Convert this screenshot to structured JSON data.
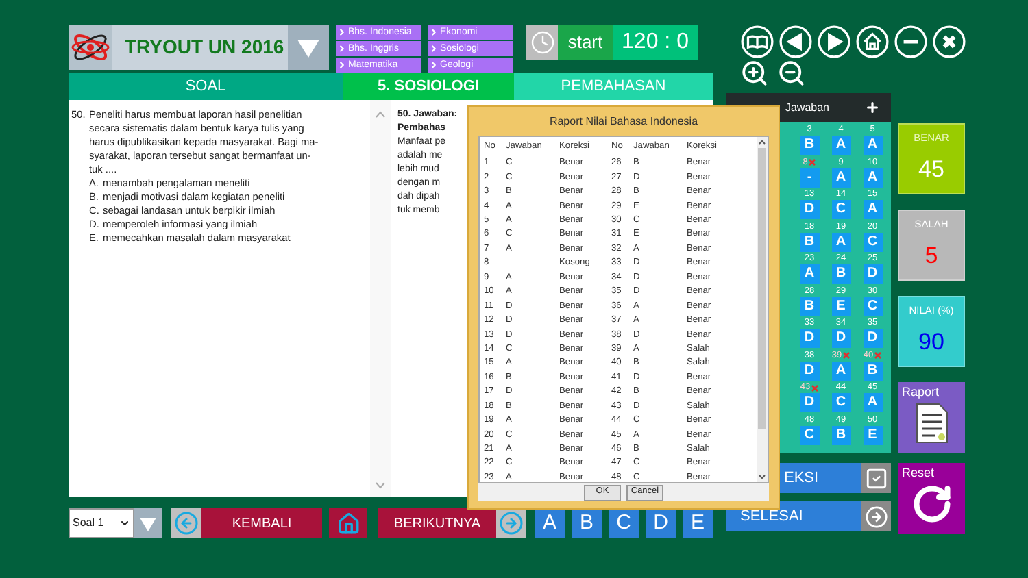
{
  "header": {
    "title": "TRYOUT UN 2016",
    "subjects": [
      {
        "label": "Bhs. Indonesia"
      },
      {
        "label": "Bhs. Inggris"
      },
      {
        "label": "Matematika"
      },
      {
        "label": "Ekonomi"
      },
      {
        "label": "Sosiologi"
      },
      {
        "label": "Geologi"
      }
    ],
    "start": "start",
    "timer": "120 : 0"
  },
  "tabs": [
    {
      "label": "SOAL",
      "selected": false,
      "color": "#00a884"
    },
    {
      "label": "5. SOSIOLOGI",
      "selected": true,
      "color": "#00c04b"
    },
    {
      "label": "PEMBAHASAN",
      "selected": false,
      "color": "#22d6a8"
    }
  ],
  "question": {
    "number": "50.",
    "lines": [
      "Peneliti harus membuat laporan hasil penelitian",
      "secara sistematis dalam bentuk karya tulis yang",
      "harus dipublikasikan kepada masyarakat. Bagi ma-",
      "syarakat, laporan tersebut sangat bermanfaat un-",
      "tuk ...."
    ],
    "options": [
      {
        "letter": "A.",
        "text": "menambah pengalaman meneliti"
      },
      {
        "letter": "B.",
        "text": "menjadi motivasi dalam kegiatan peneliti"
      },
      {
        "letter": "C.",
        "text": "sebagai landasan untuk berpikir ilmiah"
      },
      {
        "letter": "D.",
        "text": "memperoleh informasi yang ilmiah"
      },
      {
        "letter": "E.",
        "text": "memecahkan masalah dalam masyarakat"
      }
    ]
  },
  "discussion": {
    "title": "50. Jawaban:",
    "heading": "Pembahas",
    "lines": [
      "Manfaat pe",
      "adalah me",
      "lebih mud",
      "dengan m",
      "dah dipah",
      "tuk memb"
    ]
  },
  "dialog": {
    "title": "Raport Nilai Bahasa Indonesia",
    "columns": [
      "No",
      "Jawaban",
      "Koreksi",
      "No",
      "Jawaban",
      "Koreksi"
    ],
    "rows": [
      [
        "1",
        "C",
        "Benar",
        "26",
        "B",
        "Benar"
      ],
      [
        "2",
        "C",
        "Benar",
        "27",
        "D",
        "Benar"
      ],
      [
        "3",
        "B",
        "Benar",
        "28",
        "B",
        "Benar"
      ],
      [
        "4",
        "A",
        "Benar",
        "29",
        "E",
        "Benar"
      ],
      [
        "5",
        "A",
        "Benar",
        "30",
        "C",
        "Benar"
      ],
      [
        "6",
        "C",
        "Benar",
        "31",
        "E",
        "Benar"
      ],
      [
        "7",
        "A",
        "Benar",
        "32",
        "A",
        "Benar"
      ],
      [
        "8",
        "-",
        "Kosong",
        "33",
        "D",
        "Benar"
      ],
      [
        "9",
        "A",
        "Benar",
        "34",
        "D",
        "Benar"
      ],
      [
        "10",
        "A",
        "Benar",
        "35",
        "D",
        "Benar"
      ],
      [
        "11",
        "D",
        "Benar",
        "36",
        "A",
        "Benar"
      ],
      [
        "12",
        "D",
        "Benar",
        "37",
        "A",
        "Benar"
      ],
      [
        "13",
        "D",
        "Benar",
        "38",
        "D",
        "Benar"
      ],
      [
        "14",
        "C",
        "Benar",
        "39",
        "A",
        "Salah"
      ],
      [
        "15",
        "A",
        "Benar",
        "40",
        "B",
        "Salah"
      ],
      [
        "16",
        "B",
        "Benar",
        "41",
        "D",
        "Benar"
      ],
      [
        "17",
        "D",
        "Benar",
        "42",
        "B",
        "Benar"
      ],
      [
        "18",
        "B",
        "Benar",
        "43",
        "D",
        "Salah"
      ],
      [
        "19",
        "A",
        "Benar",
        "44",
        "C",
        "Benar"
      ],
      [
        "20",
        "C",
        "Benar",
        "45",
        "A",
        "Benar"
      ],
      [
        "21",
        "A",
        "Benar",
        "46",
        "B",
        "Salah"
      ],
      [
        "22",
        "C",
        "Benar",
        "47",
        "C",
        "Benar"
      ],
      [
        "23",
        "A",
        "Benar",
        "48",
        "C",
        "Benar"
      ]
    ],
    "buttons": [
      "OK",
      "Cancel"
    ]
  },
  "answer_sheet": {
    "title": "Jawaban",
    "items": [
      {
        "no": "3",
        "answer": "B",
        "crossed": false
      },
      {
        "no": "4",
        "answer": "A",
        "crossed": false
      },
      {
        "no": "5",
        "answer": "A",
        "crossed": false
      },
      {
        "no": "8",
        "answer": "-",
        "crossed": true
      },
      {
        "no": "9",
        "answer": "A",
        "crossed": false
      },
      {
        "no": "10",
        "answer": "A",
        "crossed": false
      },
      {
        "no": "13",
        "answer": "D",
        "crossed": false
      },
      {
        "no": "14",
        "answer": "C",
        "crossed": false
      },
      {
        "no": "15",
        "answer": "A",
        "crossed": false
      },
      {
        "no": "18",
        "answer": "B",
        "crossed": false
      },
      {
        "no": "19",
        "answer": "A",
        "crossed": false
      },
      {
        "no": "20",
        "answer": "C",
        "crossed": false
      },
      {
        "no": "23",
        "answer": "A",
        "crossed": false
      },
      {
        "no": "24",
        "answer": "B",
        "crossed": false
      },
      {
        "no": "25",
        "answer": "D",
        "crossed": false
      },
      {
        "no": "28",
        "answer": "B",
        "crossed": false
      },
      {
        "no": "29",
        "answer": "E",
        "crossed": false
      },
      {
        "no": "30",
        "answer": "C",
        "crossed": false
      },
      {
        "no": "33",
        "answer": "D",
        "crossed": false
      },
      {
        "no": "34",
        "answer": "D",
        "crossed": false
      },
      {
        "no": "35",
        "answer": "D",
        "crossed": false
      },
      {
        "no": "38",
        "answer": "D",
        "crossed": false
      },
      {
        "no": "39",
        "answer": "A",
        "crossed": true
      },
      {
        "no": "40",
        "answer": "B",
        "crossed": true
      },
      {
        "no": "43",
        "answer": "D",
        "crossed": true
      },
      {
        "no": "44",
        "answer": "C",
        "crossed": false
      },
      {
        "no": "45",
        "answer": "A",
        "crossed": false
      },
      {
        "no": "48",
        "answer": "C",
        "crossed": false
      },
      {
        "no": "49",
        "answer": "B",
        "crossed": false
      },
      {
        "no": "50",
        "answer": "E",
        "crossed": false
      }
    ]
  },
  "stats": [
    {
      "kind": "benar",
      "label": "BENAR",
      "value": "45"
    },
    {
      "kind": "salah",
      "label": "SALAH",
      "value": "5"
    },
    {
      "kind": "nilai",
      "label": "NILAI (%)",
      "value": "90"
    }
  ],
  "raport": "Raport",
  "reset": "Reset",
  "koreksi": "EKSI",
  "selesai": "SELESAI",
  "footer": {
    "select": "Soal 1",
    "back": "KEMBALI",
    "next": "BERIKUTNYA",
    "choices": [
      "A",
      "B",
      "C",
      "D",
      "E"
    ]
  }
}
